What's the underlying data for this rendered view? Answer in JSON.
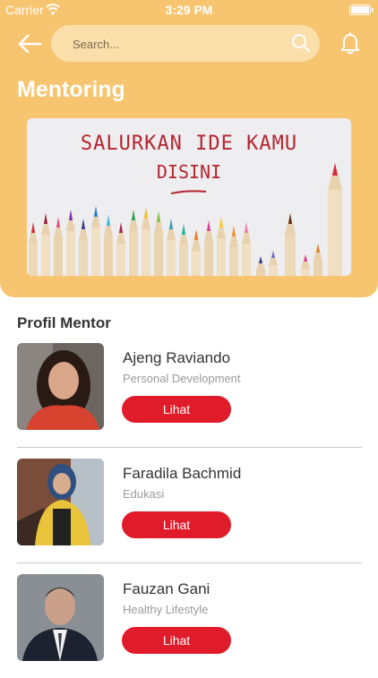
{
  "status_bar": {
    "carrier": "Carrier",
    "time": "3:29 PM"
  },
  "header": {
    "search_placeholder": "Search...",
    "title": "Mentoring",
    "background_color": "#f7c46f"
  },
  "banner": {
    "line1": "SALURKAN IDE KAMU",
    "line2": "DISINI"
  },
  "section": {
    "title": "Profil Mentor"
  },
  "mentors": [
    {
      "name": "Ajeng Raviando",
      "field": "Personal Development",
      "button": "Lihat"
    },
    {
      "name": "Faradila Bachmid",
      "field": "Edukasi",
      "button": "Lihat"
    },
    {
      "name": "Fauzan Gani",
      "field": "Healthy Lifestyle",
      "button": "Lihat"
    }
  ],
  "colors": {
    "accent": "#e01c2b",
    "header": "#f7c46f"
  }
}
